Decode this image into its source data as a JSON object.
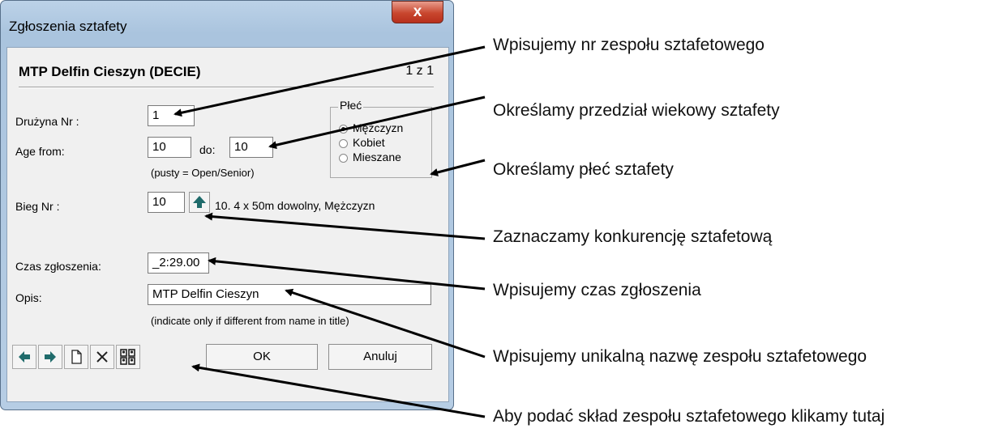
{
  "window": {
    "title": "Zgłoszenia sztafety",
    "close_symbol": "x"
  },
  "dialog": {
    "header": "MTP Delfin Cieszyn (DECIE)",
    "page_indicator": "1 z 1",
    "team_no": {
      "label": "Drużyna Nr :",
      "value": "1"
    },
    "age": {
      "label": "Age from:",
      "from_value": "10",
      "to_label": "do:",
      "to_value": "10",
      "hint": "(pusty = Open/Senior)"
    },
    "gender": {
      "title": "Płeć",
      "options": [
        "Mężczyzn",
        "Kobiet",
        "Mieszane"
      ],
      "selected": "Mężczyzn"
    },
    "event": {
      "label": "Bieg Nr :",
      "value": "10",
      "description": "10. 4 x 50m dowolny, Mężczyzn"
    },
    "entry_time": {
      "label": "Czas zgłoszenia:",
      "value": "_2:29.00"
    },
    "description": {
      "label": "Opis:",
      "value": "MTP Delfin Cieszyn",
      "hint": "(indicate only if different from name in title)"
    },
    "buttons": {
      "ok": "OK",
      "cancel": "Anuluj"
    }
  },
  "annotations": [
    "Wpisujemy nr zespołu sztafetowego",
    "Określamy przedział wiekowy sztafety",
    "Określamy płeć sztafety",
    "Zaznaczamy konkurencję sztafetową",
    "Wpisujemy czas zgłoszenia",
    "Wpisujemy unikalną nazwę zespołu sztafetowego",
    "Aby podać skład zespołu sztafetowego klikamy tutaj"
  ],
  "icons": [
    "close-icon",
    "arrow-up-icon",
    "prev-arrow-icon",
    "next-arrow-icon",
    "new-document-icon",
    "delete-icon",
    "team-members-icon"
  ]
}
